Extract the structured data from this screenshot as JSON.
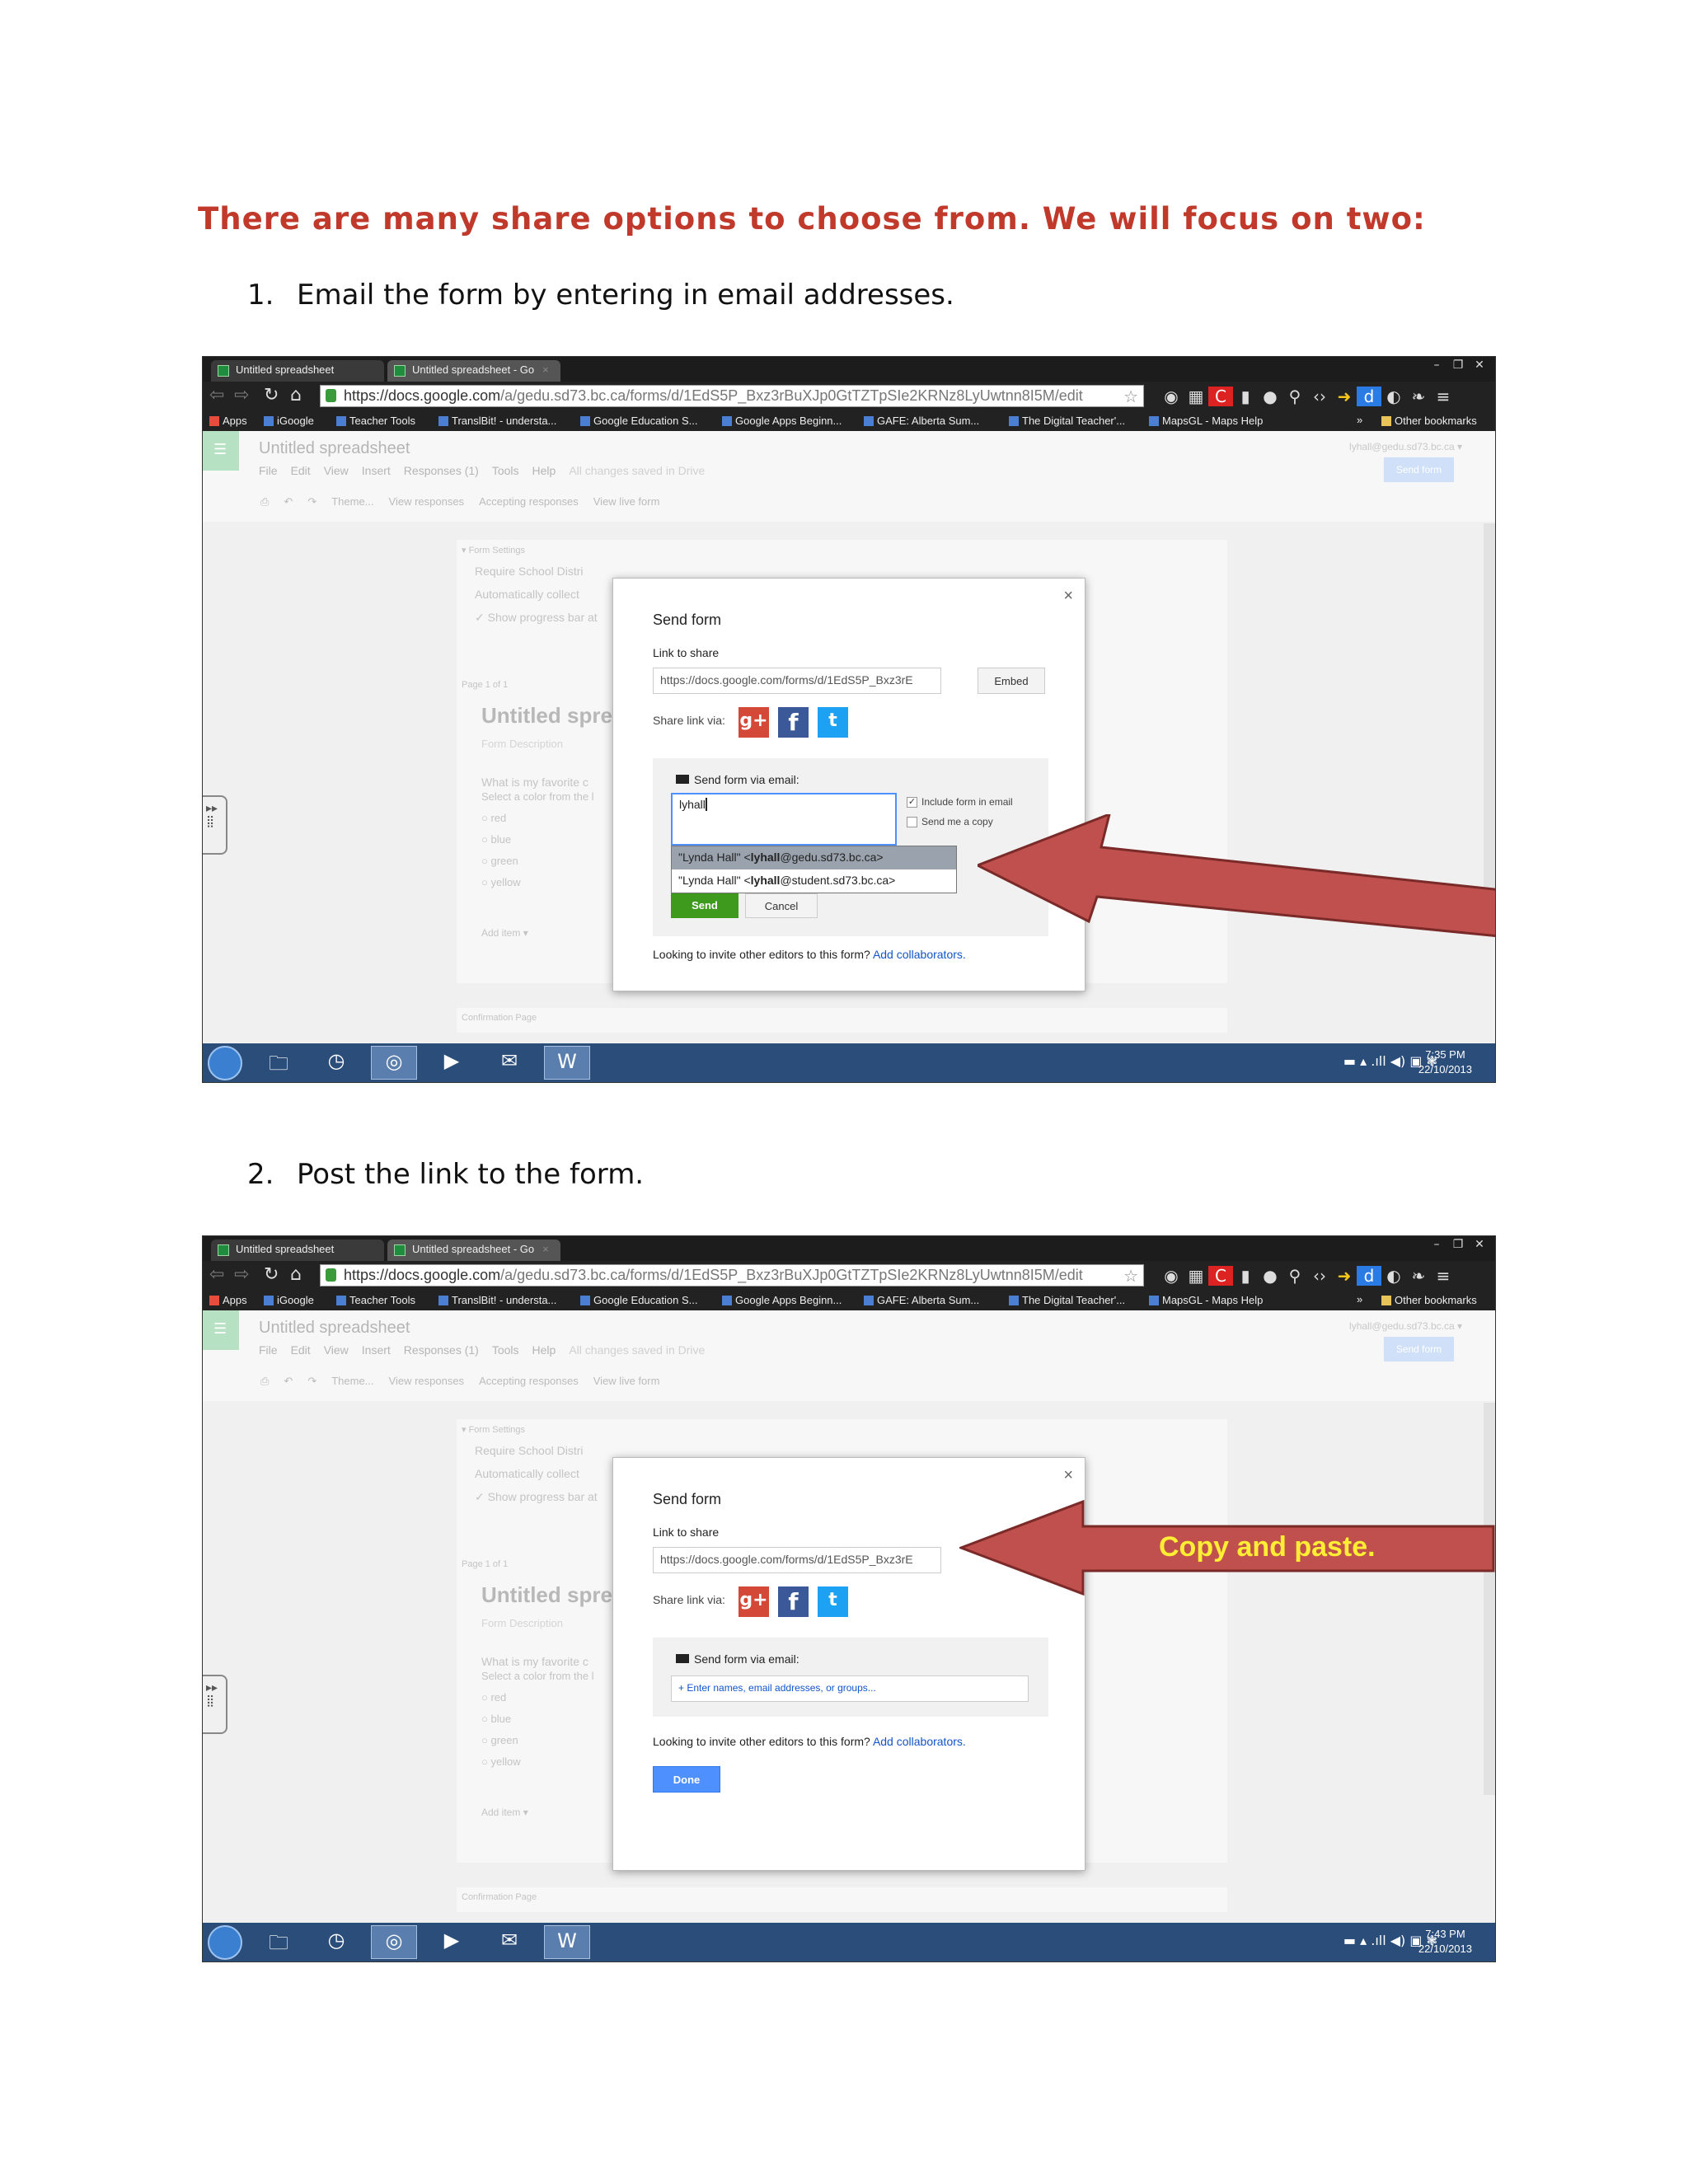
{
  "heading": "There are many share options to choose from. We will focus on two:",
  "steps": [
    {
      "num": "1.",
      "text": "Email the form by entering in email addresses."
    },
    {
      "num": "2.",
      "text": "Post the link to the form."
    }
  ],
  "browser": {
    "tabs": [
      "Untitled spreadsheet",
      "Untitled spreadsheet - Go"
    ],
    "tab_close": "×",
    "window_controls": [
      "–",
      "❐",
      "✕"
    ],
    "nav_icons": [
      "back-icon",
      "forward-icon",
      "reload-icon",
      "home-icon"
    ],
    "url_host": "https://docs.google.com",
    "url_path": "/a/gedu.sd73.bc.ca/forms/d/1EdS5P_Bxz3rBuXJp0GtTZTpSIe2KRNz8LyUwtnn8I5M/edit",
    "bookmarks": [
      "Apps",
      "iGoogle",
      "Teacher Tools",
      "TranslBit! - understa...",
      "Google Education S...",
      "Google Apps Beginn...",
      "GAFE: Alberta Sum...",
      "The Digital Teacher'...",
      "MapsGL - Maps Help"
    ],
    "bookmarks_more": "»",
    "other_bookmarks": "Other bookmarks"
  },
  "app": {
    "doc_title": "Untitled spreadsheet",
    "menus": [
      "File",
      "Edit",
      "View",
      "Insert",
      "Responses (1)",
      "Tools",
      "Help",
      "All changes saved in Drive"
    ],
    "toolbar": [
      "Theme...",
      "View responses",
      "Accepting responses",
      "View live form"
    ],
    "user_email": "lyhall@gedu.sd73.bc.ca ▾",
    "send_form_button": "Send form",
    "form_settings": "▾ Form Settings",
    "settings_items": [
      "Require School Distri",
      "Automatically collect",
      "✓ Show progress bar at"
    ],
    "page_label": "Page 1 of 1",
    "form_title": "Untitled spre",
    "form_description": "Form Description",
    "question": "What is my favorite c",
    "question_help": "Select a color from the l",
    "options": [
      "red",
      "blue",
      "green",
      "yellow"
    ],
    "add_item": "Add item   ▾",
    "confirmation_page": "Confirmation Page",
    "side_handle": "▸▸\n⣿"
  },
  "dialog": {
    "close": "×",
    "title": "Send form",
    "link_label": "Link to share",
    "link_value": "https://docs.google.com/forms/d/1EdS5P_Bxz3rE",
    "embed": "Embed",
    "share_via": "Share link via:",
    "social": {
      "gplus": "g+",
      "facebook": "f",
      "twitter": "t"
    },
    "email_label": "Send form via email:",
    "include_form": "Include form in email",
    "send_copy": "Send me a copy",
    "collab_prefix": "Looking to invite other editors to this form?",
    "collab_link": "Add collaborators.",
    "send": "Send",
    "cancel": "Cancel",
    "done": "Done"
  },
  "shot1": {
    "typed": "lyhall",
    "suggestions": [
      {
        "name": "\"Lynda Hall\" <",
        "user": "lyhall",
        "domain": "@gedu.sd73.bc.ca>"
      },
      {
        "name": "\"Lynda Hall\" <",
        "user": "lyhall",
        "domain": "@student.sd73.bc.ca>"
      }
    ],
    "time": "7:35 PM",
    "date": "22/10/2013"
  },
  "shot2": {
    "email_placeholder": "+ Enter names, email addresses, or groups...",
    "arrow_label": "Copy and paste.",
    "time": "7:43 PM",
    "date": "22/10/2013"
  },
  "taskbar": {
    "icons": [
      "start-orb-icon",
      "folder-icon",
      "clock-icon",
      "chrome-icon",
      "media-player-icon",
      "mail-icon",
      "word-icon"
    ],
    "tray": "▬  ▴  .ıll  ◀)  ▣  ❃"
  },
  "colors": {
    "heading": "#c0392b",
    "arrow_fill": "#c0504d",
    "arrow_stroke": "#7a2a28",
    "arrow_text": "#ffee33"
  }
}
